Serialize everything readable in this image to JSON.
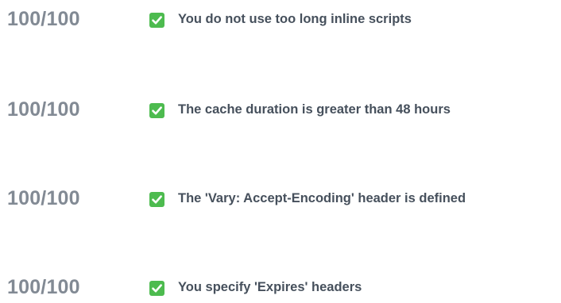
{
  "colors": {
    "score": "#828a94",
    "text": "#46505c",
    "check_bg": "#4dbb4f",
    "check_mark": "#ffffff"
  },
  "rules": [
    {
      "score": "100/100",
      "icon": "check-icon",
      "label": "You do not use too long inline scripts"
    },
    {
      "score": "100/100",
      "icon": "check-icon",
      "label": "The cache duration is greater than 48 hours"
    },
    {
      "score": "100/100",
      "icon": "check-icon",
      "label": "The 'Vary: Accept-Encoding' header is defined"
    },
    {
      "score": "100/100",
      "icon": "check-icon",
      "label": "You specify 'Expires' headers"
    }
  ]
}
